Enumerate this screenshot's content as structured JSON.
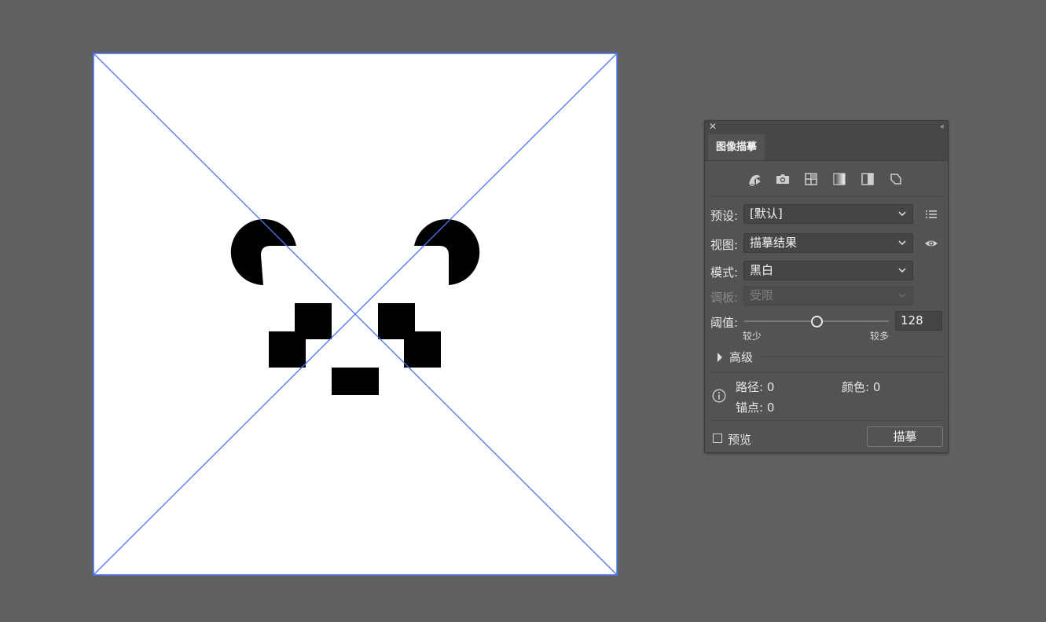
{
  "colors": {
    "workspace_bg": "#616161",
    "artboard_bg": "#ffffff",
    "selection_blue": "#4a74f5",
    "panel_bg": "#535353"
  },
  "artboard": {
    "image_content": "black-and-white panda face graphic on a placed image with selection cross lines"
  },
  "panel": {
    "close_icon": "close-icon",
    "collapse_icon": "double-chevron-left-icon",
    "tab_label": "图像描摹",
    "preset_icons": [
      "auto-color-icon",
      "camera-icon",
      "grid-icon",
      "gradient-icon",
      "half-fill-icon",
      "outline-icon"
    ],
    "preset": {
      "label": "预设:",
      "value": "[默认]"
    },
    "view": {
      "label": "视图:",
      "value": "描摹结果"
    },
    "mode": {
      "label": "模式:",
      "value": "黑白"
    },
    "palette": {
      "label": "调板:",
      "value": "受限"
    },
    "threshold": {
      "label": "阈值:",
      "value": "128",
      "min_label": "较少",
      "max_label": "较多",
      "level": 128,
      "range": [
        1,
        255
      ]
    },
    "advanced_label": "高级",
    "stats": {
      "paths": "路径: 0",
      "colors": "颜色: 0",
      "anchors": "锚点: 0"
    },
    "preview_label": "预览",
    "trace_button": "描摹"
  }
}
